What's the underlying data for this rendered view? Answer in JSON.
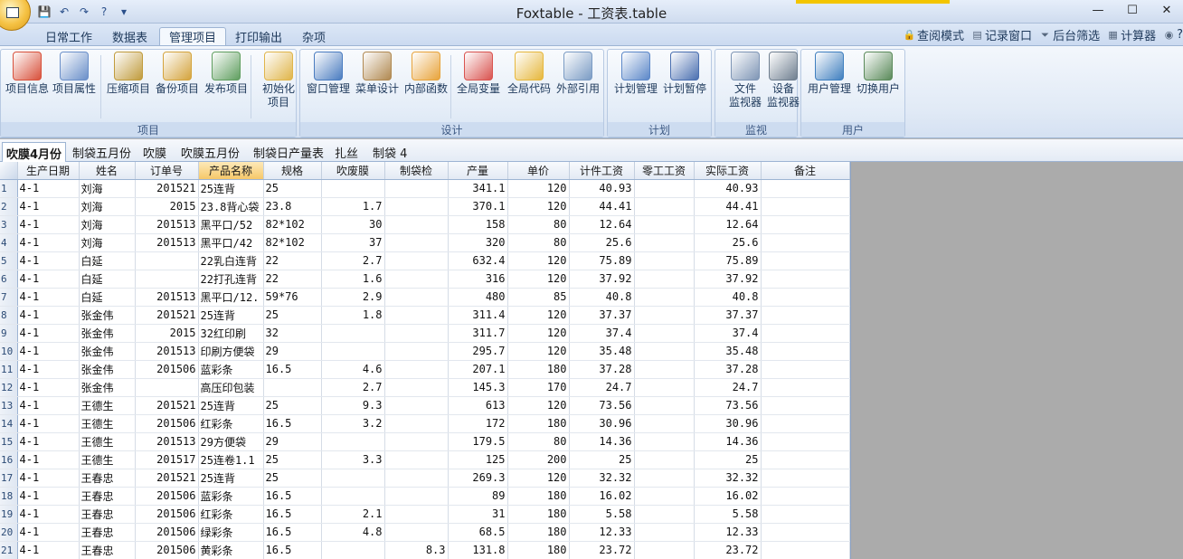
{
  "app": {
    "title": "Foxtable - 工资表.table"
  },
  "quick_access": {
    "icons": [
      "save-icon",
      "undo-icon",
      "redo-icon",
      "help-icon",
      "dropdown-icon"
    ],
    "glyphs": [
      "💾",
      "↶",
      "↷",
      "?",
      "▾"
    ]
  },
  "window_controls": {
    "minimize": "—",
    "maximize": "☐",
    "close": "✕"
  },
  "ribbon_tabs": [
    {
      "label": "日常工作"
    },
    {
      "label": "数据表"
    },
    {
      "label": "管理项目",
      "active": true
    },
    {
      "label": "打印输出"
    },
    {
      "label": "杂项"
    }
  ],
  "right_menu": [
    {
      "label": "查阅模式",
      "icon": "🔒"
    },
    {
      "label": "记录窗口",
      "icon": "▤"
    },
    {
      "label": "后台筛选",
      "icon": "⏷"
    },
    {
      "label": "计算器",
      "icon": "▦"
    },
    {
      "label": "?",
      "icon": "◉"
    }
  ],
  "ribbon_groups": [
    {
      "label": "项目",
      "buttons": [
        {
          "label": "项目信息",
          "icon": "project-info-icon"
        },
        {
          "label": "项目属性",
          "icon": "project-properties-icon"
        },
        {
          "label": "压缩项目",
          "icon": "compress-project-icon"
        },
        {
          "label": "备份项目",
          "icon": "backup-project-icon"
        },
        {
          "label": "发布项目",
          "icon": "publish-project-icon"
        },
        {
          "label": "初始化\n项目",
          "icon": "init-project-icon"
        }
      ]
    },
    {
      "label": "设计",
      "buttons": [
        {
          "label": "窗口管理",
          "icon": "window-manage-icon"
        },
        {
          "label": "菜单设计",
          "icon": "menu-design-icon"
        },
        {
          "label": "内部函数",
          "icon": "internal-function-icon"
        },
        {
          "label": "全局变量",
          "icon": "global-variable-icon"
        },
        {
          "label": "全局代码",
          "icon": "global-code-icon"
        },
        {
          "label": "外部引用",
          "icon": "external-reference-icon"
        }
      ]
    },
    {
      "label": "计划",
      "buttons": [
        {
          "label": "计划管理",
          "icon": "schedule-manage-icon"
        },
        {
          "label": "计划暂停",
          "icon": "schedule-pause-icon"
        }
      ]
    },
    {
      "label": "监视",
      "buttons": [
        {
          "label": "文件\n监视器",
          "icon": "file-monitor-icon"
        },
        {
          "label": "设备\n监视器",
          "icon": "device-monitor-icon"
        }
      ]
    },
    {
      "label": "用户",
      "buttons": [
        {
          "label": "用户管理",
          "icon": "user-manage-icon"
        },
        {
          "label": "切换用户",
          "icon": "switch-user-icon"
        }
      ]
    }
  ],
  "sheet_tabs": [
    {
      "label": "吹膜4月份",
      "active": true
    },
    {
      "label": "制袋五月份"
    },
    {
      "label": "吹膜"
    },
    {
      "label": "吹膜五月份"
    },
    {
      "label": "制袋日产量表"
    },
    {
      "label": "扎丝"
    },
    {
      "label": "制袋 4"
    }
  ],
  "grid": {
    "columns": [
      "生产日期",
      "姓名",
      "订单号",
      "产品名称",
      "规格",
      "吹废膜",
      "制袋检",
      "产量",
      "单价",
      "计件工资",
      "零工工资",
      "实际工资",
      "备注"
    ],
    "selected_column": 3,
    "rows": [
      [
        "1",
        "4-1",
        "刘海",
        "201521",
        "25连背",
        "25",
        "",
        "",
        "341.1",
        "120",
        "40.93",
        "",
        "40.93",
        ""
      ],
      [
        "2",
        "4-1",
        "刘海",
        "2015",
        "23.8背心袋",
        "23.8",
        "1.7",
        "",
        "370.1",
        "120",
        "44.41",
        "",
        "44.41",
        ""
      ],
      [
        "3",
        "4-1",
        "刘海",
        "201513",
        "黑平口/52",
        "82*102",
        "30",
        "",
        "158",
        "80",
        "12.64",
        "",
        "12.64",
        ""
      ],
      [
        "4",
        "4-1",
        "刘海",
        "201513",
        "黑平口/42",
        "82*102",
        "37",
        "",
        "320",
        "80",
        "25.6",
        "",
        "25.6",
        ""
      ],
      [
        "5",
        "4-1",
        "白延",
        "",
        "22乳白连背",
        "22",
        "2.7",
        "",
        "632.4",
        "120",
        "75.89",
        "",
        "75.89",
        ""
      ],
      [
        "6",
        "4-1",
        "白延",
        "",
        "22打孔连背",
        "22",
        "1.6",
        "",
        "316",
        "120",
        "37.92",
        "",
        "37.92",
        ""
      ],
      [
        "7",
        "4-1",
        "白延",
        "201513",
        "黑平口/12.",
        "59*76",
        "2.9",
        "",
        "480",
        "85",
        "40.8",
        "",
        "40.8",
        ""
      ],
      [
        "8",
        "4-1",
        "张金伟",
        "201521",
        "25连背",
        "25",
        "1.8",
        "",
        "311.4",
        "120",
        "37.37",
        "",
        "37.37",
        ""
      ],
      [
        "9",
        "4-1",
        "张金伟",
        "2015",
        "32红印刷",
        "32",
        "",
        "",
        "311.7",
        "120",
        "37.4",
        "",
        "37.4",
        ""
      ],
      [
        "10",
        "4-1",
        "张金伟",
        "201513",
        "印刷方便袋",
        "29",
        "",
        "",
        "295.7",
        "120",
        "35.48",
        "",
        "35.48",
        ""
      ],
      [
        "11",
        "4-1",
        "张金伟",
        "201506",
        "蓝彩条",
        "16.5",
        "4.6",
        "",
        "207.1",
        "180",
        "37.28",
        "",
        "37.28",
        ""
      ],
      [
        "12",
        "4-1",
        "张金伟",
        "",
        "高压印包装",
        "",
        "2.7",
        "",
        "145.3",
        "170",
        "24.7",
        "",
        "24.7",
        ""
      ],
      [
        "13",
        "4-1",
        "王德生",
        "201521",
        "25连背",
        "25",
        "9.3",
        "",
        "613",
        "120",
        "73.56",
        "",
        "73.56",
        ""
      ],
      [
        "14",
        "4-1",
        "王德生",
        "201506",
        "红彩条",
        "16.5",
        "3.2",
        "",
        "172",
        "180",
        "30.96",
        "",
        "30.96",
        ""
      ],
      [
        "15",
        "4-1",
        "王德生",
        "201513",
        "29方便袋",
        "29",
        "",
        "",
        "179.5",
        "80",
        "14.36",
        "",
        "14.36",
        ""
      ],
      [
        "16",
        "4-1",
        "王德生",
        "201517",
        "25连卷1.1",
        "25",
        "3.3",
        "",
        "125",
        "200",
        "25",
        "",
        "25",
        ""
      ],
      [
        "17",
        "4-1",
        "王春忠",
        "201521",
        "25连背",
        "25",
        "",
        "",
        "269.3",
        "120",
        "32.32",
        "",
        "32.32",
        ""
      ],
      [
        "18",
        "4-1",
        "王春忠",
        "201506",
        "蓝彩条",
        "16.5",
        "",
        "",
        "89",
        "180",
        "16.02",
        "",
        "16.02",
        ""
      ],
      [
        "19",
        "4-1",
        "王春忠",
        "201506",
        "红彩条",
        "16.5",
        "2.1",
        "",
        "31",
        "180",
        "5.58",
        "",
        "5.58",
        ""
      ],
      [
        "20",
        "4-1",
        "王春忠",
        "201506",
        "绿彩条",
        "16.5",
        "4.8",
        "",
        "68.5",
        "180",
        "12.33",
        "",
        "12.33",
        ""
      ],
      [
        "21",
        "4-1",
        "王春忠",
        "201506",
        "黄彩条",
        "16.5",
        "",
        "8.3",
        "131.8",
        "180",
        "23.72",
        "",
        "23.72",
        ""
      ]
    ]
  }
}
